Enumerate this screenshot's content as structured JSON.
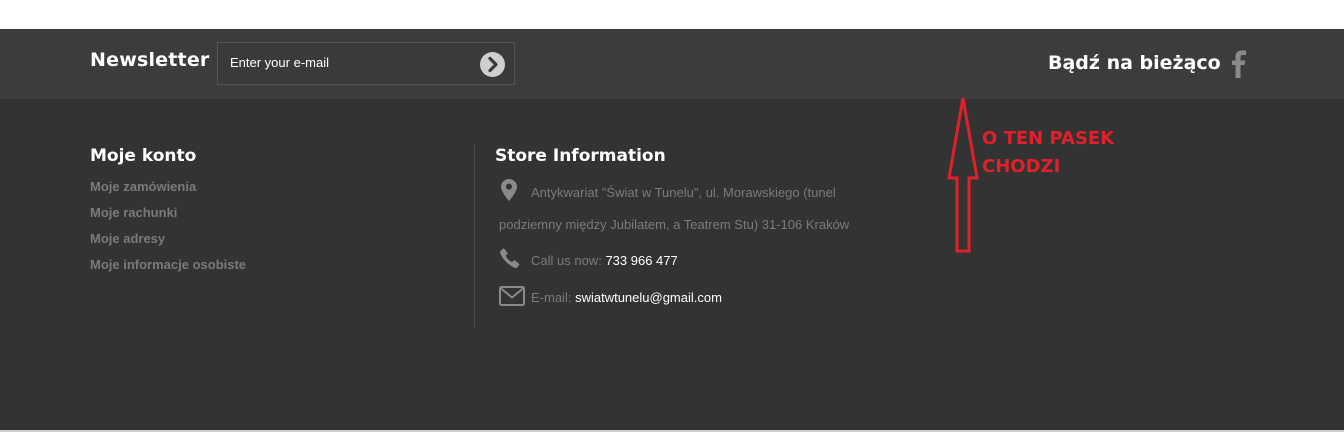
{
  "newsletter": {
    "title": "Newsletter",
    "input_placeholder": "Enter your e-mail",
    "submit_icon": "chevron-right-circle-icon"
  },
  "social": {
    "title": "Bądź na bieżąco",
    "facebook_icon": "facebook-icon"
  },
  "account": {
    "title": "Moje konto",
    "links": [
      "Moje zamówienia",
      "Moje rachunki",
      "Moje adresy",
      "Moje informacje osobiste"
    ]
  },
  "store_info": {
    "title": "Store Information",
    "address_line1": "Antykwariat \"Świat w Tunelu\", ul. Morawskiego (tunel",
    "address_line2": "podziemny między Jubilatem, a Teatrem Stu) 31-106 Kraków",
    "phone_label": "Call us now:",
    "phone": "733 966 477",
    "email_label": "E-mail:",
    "email": "swiatwtunelu@gmail.com"
  },
  "annotation": {
    "line1": "O TEN PASEK",
    "line2": "CHODZI",
    "color": "#e0202a"
  },
  "colors": {
    "topbar_bg": "#3c3c3c",
    "footer_bg": "#333333",
    "muted_text": "#7a7a7a"
  }
}
